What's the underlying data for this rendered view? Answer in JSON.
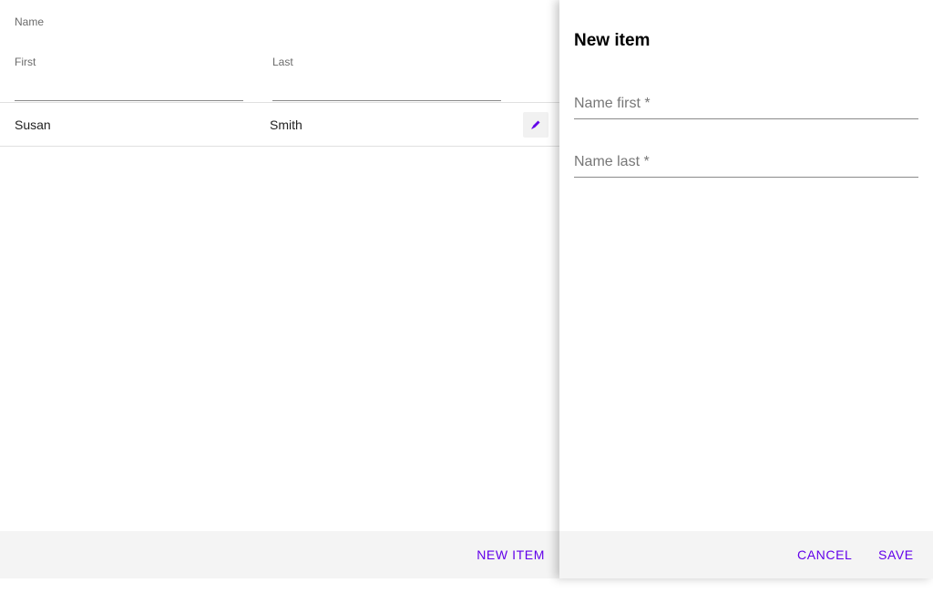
{
  "grid": {
    "group_header": "Name",
    "columns": [
      {
        "label": "First"
      },
      {
        "label": "Last"
      }
    ],
    "rows": [
      {
        "first": "Susan",
        "last": "Smith",
        "action_icon": "pencil-icon"
      }
    ],
    "footer": {
      "new_item_label": "NEW ITEM"
    }
  },
  "drawer": {
    "title": "New item",
    "fields": {
      "first_placeholder": "Name first *",
      "last_placeholder": "Name last *"
    },
    "footer": {
      "cancel_label": "CANCEL",
      "save_label": "SAVE"
    }
  },
  "colors": {
    "accent": "#6200ea",
    "footer_bg": "#f4f4f4",
    "divider": "#e0e0e0"
  }
}
